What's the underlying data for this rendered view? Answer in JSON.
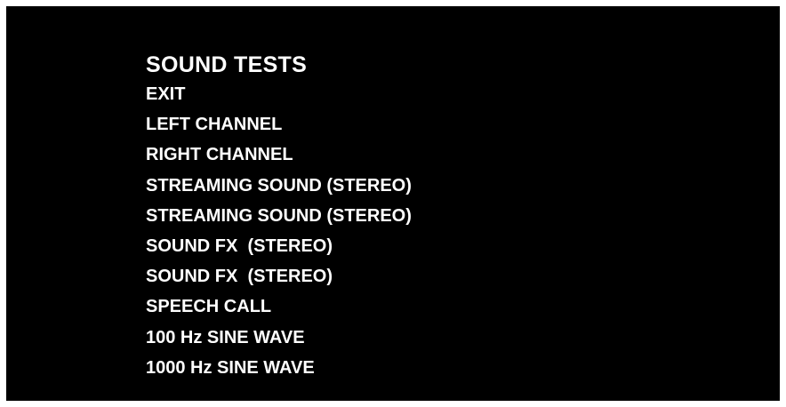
{
  "screen": {
    "background": "#000000",
    "text_color": "#ffffff"
  },
  "menu": {
    "title": "SOUND TESTS",
    "items": [
      {
        "label": "EXIT"
      },
      {
        "label": "LEFT CHANNEL"
      },
      {
        "label": "RIGHT CHANNEL"
      },
      {
        "label": "STREAMING SOUND (STEREO)"
      },
      {
        "label": "STREAMING SOUND (STEREO)"
      },
      {
        "label": "SOUND FX  (STEREO)"
      },
      {
        "label": "SOUND FX  (STEREO)"
      },
      {
        "label": "SPEECH CALL"
      },
      {
        "label": "100 Hz SINE WAVE"
      },
      {
        "label": "1000 Hz SINE WAVE"
      }
    ]
  }
}
